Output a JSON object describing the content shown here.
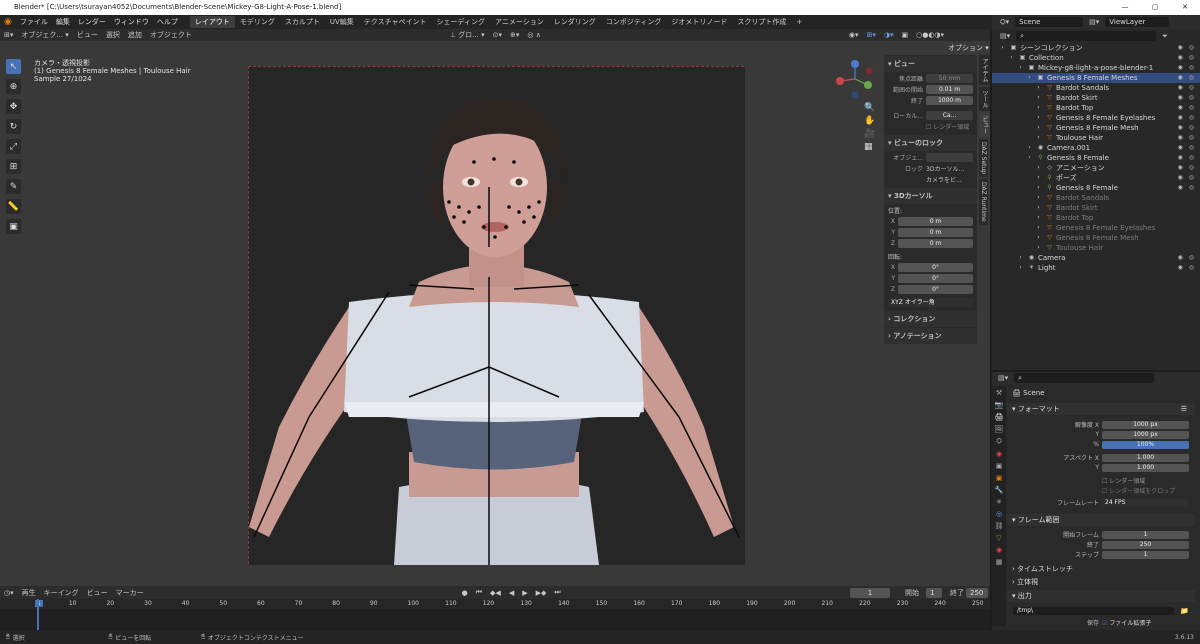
{
  "window": {
    "title": "Blender* [C:\\Users\\tsurayan4052\\Documents\\Blender-Scene\\Mickey-G8-Light-A-Pose-1.blend]"
  },
  "menubar": {
    "menus": [
      "ファイル",
      "編集",
      "レンダー",
      "ウィンドウ",
      "ヘルプ"
    ],
    "workspaces": [
      "レイアウト",
      "モデリング",
      "スカルプト",
      "UV編集",
      "テクスチャペイント",
      "シェーディング",
      "アニメーション",
      "レンダリング",
      "コンポジティング",
      "ジオメトリノード",
      "スクリプト作成"
    ],
    "active_workspace": 0,
    "scene": "Scene",
    "view_layer": "ViewLayer"
  },
  "viewport_header": {
    "mode": "オブジェク...",
    "menus": [
      "ビュー",
      "選択",
      "追加",
      "オブジェクト"
    ],
    "transform": "グロ...",
    "options": "オプション"
  },
  "viewport_info": {
    "line1": "カメラ・透視投影",
    "line2": "(1) Genesis 8 Female Meshes | Toulouse Hair",
    "line3": "Sample 27/1024"
  },
  "npanel": {
    "view_title": "ビュー",
    "focal_label": "焦点距離",
    "focal_value": "50 mm",
    "clip_start_label": "範囲の開始",
    "clip_start_value": "0.01 m",
    "clip_end_label": "終了",
    "clip_end_value": "1000 m",
    "local_camera_label": "ローカル...",
    "local_camera_value": "Ca...",
    "render_region_label": "レンダー領域",
    "view_lock_title": "ビューのロック",
    "lock_object_label": "オブジェ...",
    "lock_label": "ロック",
    "lock_3dcursor_label": "3Dカーソル...",
    "lock_camera_label": "カメラをビ...",
    "cursor_title": "3Dカーソル",
    "location_label": "位置:",
    "x_label": "X",
    "x_value": "0 m",
    "y_label": "Y",
    "y_value": "0 m",
    "z_label": "Z",
    "z_value": "0 m",
    "rotation_label": "回転:",
    "rx_value": "0°",
    "ry_value": "0°",
    "rz_value": "0°",
    "rotation_mode": "XYZ オイラー角",
    "collection_title": "コレクション",
    "annotation_title": "アノテーション"
  },
  "side_tabs": [
    "アイテム",
    "ツール",
    "ビュー",
    "DAZ Setup",
    "DAZ Runtime"
  ],
  "outliner": {
    "rows": [
      {
        "label": "シーンコレクション",
        "indent": 0,
        "icon": "▣",
        "dim": false,
        "sel": false
      },
      {
        "label": "Collection",
        "indent": 1,
        "icon": "▣",
        "dim": false,
        "sel": false
      },
      {
        "label": "Mickey-g8-light-a-pose-blender-1",
        "indent": 2,
        "icon": "▣",
        "dim": false,
        "sel": false
      },
      {
        "label": "Genesis 8 Female Meshes",
        "indent": 3,
        "icon": "▣",
        "dim": false,
        "sel": true
      },
      {
        "label": "Bardot Sandals",
        "indent": 4,
        "icon": "▽",
        "dim": false,
        "sel": false
      },
      {
        "label": "Bardot Skirt",
        "indent": 4,
        "icon": "▽",
        "dim": false,
        "sel": false
      },
      {
        "label": "Bardot Top",
        "indent": 4,
        "icon": "▽",
        "dim": false,
        "sel": false
      },
      {
        "label": "Genesis 8 Female Eyelashes",
        "indent": 4,
        "icon": "▽",
        "dim": false,
        "sel": false
      },
      {
        "label": "Genesis 8 Female Mesh",
        "indent": 4,
        "icon": "▽",
        "dim": false,
        "sel": false
      },
      {
        "label": "Toulouse Hair",
        "indent": 4,
        "icon": "▽",
        "dim": false,
        "sel": false
      },
      {
        "label": "Camera.001",
        "indent": 3,
        "icon": "◉",
        "dim": false,
        "sel": false
      },
      {
        "label": "Genesis 8 Female",
        "indent": 3,
        "icon": "⚲",
        "dim": false,
        "sel": false
      },
      {
        "label": "アニメーション",
        "indent": 4,
        "icon": "◇",
        "dim": false,
        "sel": false
      },
      {
        "label": "ポーズ",
        "indent": 4,
        "icon": "⚲",
        "dim": false,
        "sel": false
      },
      {
        "label": "Genesis 8 Female",
        "indent": 4,
        "icon": "⚲",
        "dim": false,
        "sel": false
      },
      {
        "label": "Bardot Sandals",
        "indent": 4,
        "icon": "▽",
        "dim": true,
        "sel": false
      },
      {
        "label": "Bardot Skirt",
        "indent": 4,
        "icon": "▽",
        "dim": true,
        "sel": false
      },
      {
        "label": "Bardot Top",
        "indent": 4,
        "icon": "▽",
        "dim": true,
        "sel": false
      },
      {
        "label": "Genesis 8 Female Eyelashes",
        "indent": 4,
        "icon": "▽",
        "dim": true,
        "sel": false
      },
      {
        "label": "Genesis 8 Female Mesh",
        "indent": 4,
        "icon": "▽",
        "dim": true,
        "sel": false
      },
      {
        "label": "Toulouse Hair",
        "indent": 4,
        "icon": "▽",
        "dim": true,
        "sel": false
      },
      {
        "label": "Camera",
        "indent": 2,
        "icon": "◉",
        "dim": false,
        "sel": false
      },
      {
        "label": "Light",
        "indent": 2,
        "icon": "☀",
        "dim": false,
        "sel": false
      }
    ]
  },
  "properties": {
    "scene_label": "Scene",
    "format_title": "フォーマット",
    "resx_label": "解像度 X",
    "resx_value": "1000 px",
    "resy_label": "Y",
    "resy_value": "1000 px",
    "pct_label": "%",
    "pct_value": "100%",
    "aspx_label": "アスペクト X",
    "aspx_value": "1.000",
    "aspy_label": "Y",
    "aspy_value": "1.000",
    "render_region": "レンダー領域",
    "crop_region": "レンダー領域をクロップ",
    "fps_label": "フレームレート",
    "fps_value": "24 FPS",
    "range_title": "フレーム範囲",
    "start_label": "開始フレーム",
    "start_value": "1",
    "end_label": "終了",
    "end_value": "250",
    "step_label": "ステップ",
    "step_value": "1",
    "time_stretch": "タイムストレッチ",
    "stereo": "立体視",
    "output_title": "出力",
    "output_path": "/tmp\\",
    "save_label": "保存",
    "file_ext_label": "ファイル拡張子"
  },
  "timeline": {
    "menus": [
      "再生",
      "キーイング",
      "ビュー",
      "マーカー"
    ],
    "current_frame": "1",
    "start_label": "開始",
    "start_value": "1",
    "end_label": "終了",
    "end_value": "250",
    "ticks": [
      "1",
      "10",
      "20",
      "30",
      "40",
      "50",
      "60",
      "70",
      "80",
      "90",
      "100",
      "110",
      "120",
      "130",
      "140",
      "150",
      "160",
      "170",
      "180",
      "190",
      "200",
      "210",
      "220",
      "230",
      "240",
      "250"
    ]
  },
  "statusbar": {
    "select": "選択",
    "rotate": "ビューを回転",
    "context_menu": "オブジェクトコンテクストメニュー",
    "version": "3.6.13"
  }
}
